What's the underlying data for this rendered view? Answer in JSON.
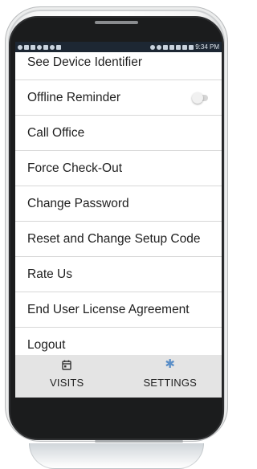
{
  "status_bar": {
    "time": "9:34 PM",
    "left_icons": [
      "settings-icon",
      "image-icon",
      "voicemail-icon",
      "wifi-icon",
      "nfc-icon",
      "cloud-icon",
      "gallery-icon"
    ],
    "right_icons": [
      "sync-icon",
      "location-icon",
      "bluetooth-icon",
      "mute-icon",
      "wifi-signal-icon",
      "cell-signal-icon",
      "battery-icon"
    ]
  },
  "menu": {
    "items": [
      {
        "label": "See Device Identifier"
      },
      {
        "label": "Offline Reminder",
        "toggle": false
      },
      {
        "label": "Call Office"
      },
      {
        "label": "Force Check-Out"
      },
      {
        "label": "Change Password"
      },
      {
        "label": "Reset and Change Setup Code"
      },
      {
        "label": "Rate Us"
      },
      {
        "label": "End User License Agreement"
      },
      {
        "label": "Logout"
      }
    ]
  },
  "tabbar": {
    "tabs": [
      {
        "label": "VISITS",
        "icon": "calendar-icon"
      },
      {
        "label": "SETTINGS",
        "icon": "gear-icon",
        "active": true
      }
    ]
  },
  "colors": {
    "status_bar_bg": "#1d2733",
    "tabbar_bg": "#e4e4e4",
    "settings_icon": "#5a8ec7",
    "divider": "#d7d7d7"
  }
}
